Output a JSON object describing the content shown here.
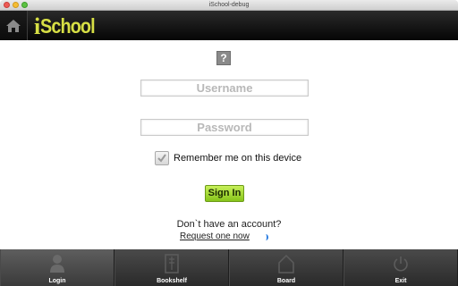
{
  "window": {
    "title": "iSchool-debug"
  },
  "header": {
    "logo_i": "i",
    "logo_rest": "School"
  },
  "form": {
    "help_glyph": "?",
    "username_placeholder": "Username",
    "password_placeholder": "Password",
    "remember_label": "Remember me on this device",
    "remember_checked": true,
    "signin_label": "Sign In",
    "no_account_text": "Don`t have an account?",
    "request_link": "Request one now"
  },
  "tabs": [
    {
      "label": "Login",
      "icon": "person-icon",
      "active": true
    },
    {
      "label": "Bookshelf",
      "icon": "book-icon",
      "active": false
    },
    {
      "label": "Board",
      "icon": "board-icon",
      "active": false
    },
    {
      "label": "Exit",
      "icon": "power-icon",
      "active": false
    }
  ],
  "colors": {
    "accent": "#d7df45",
    "signin": "#a5dc35",
    "tabbar": "#333333"
  }
}
